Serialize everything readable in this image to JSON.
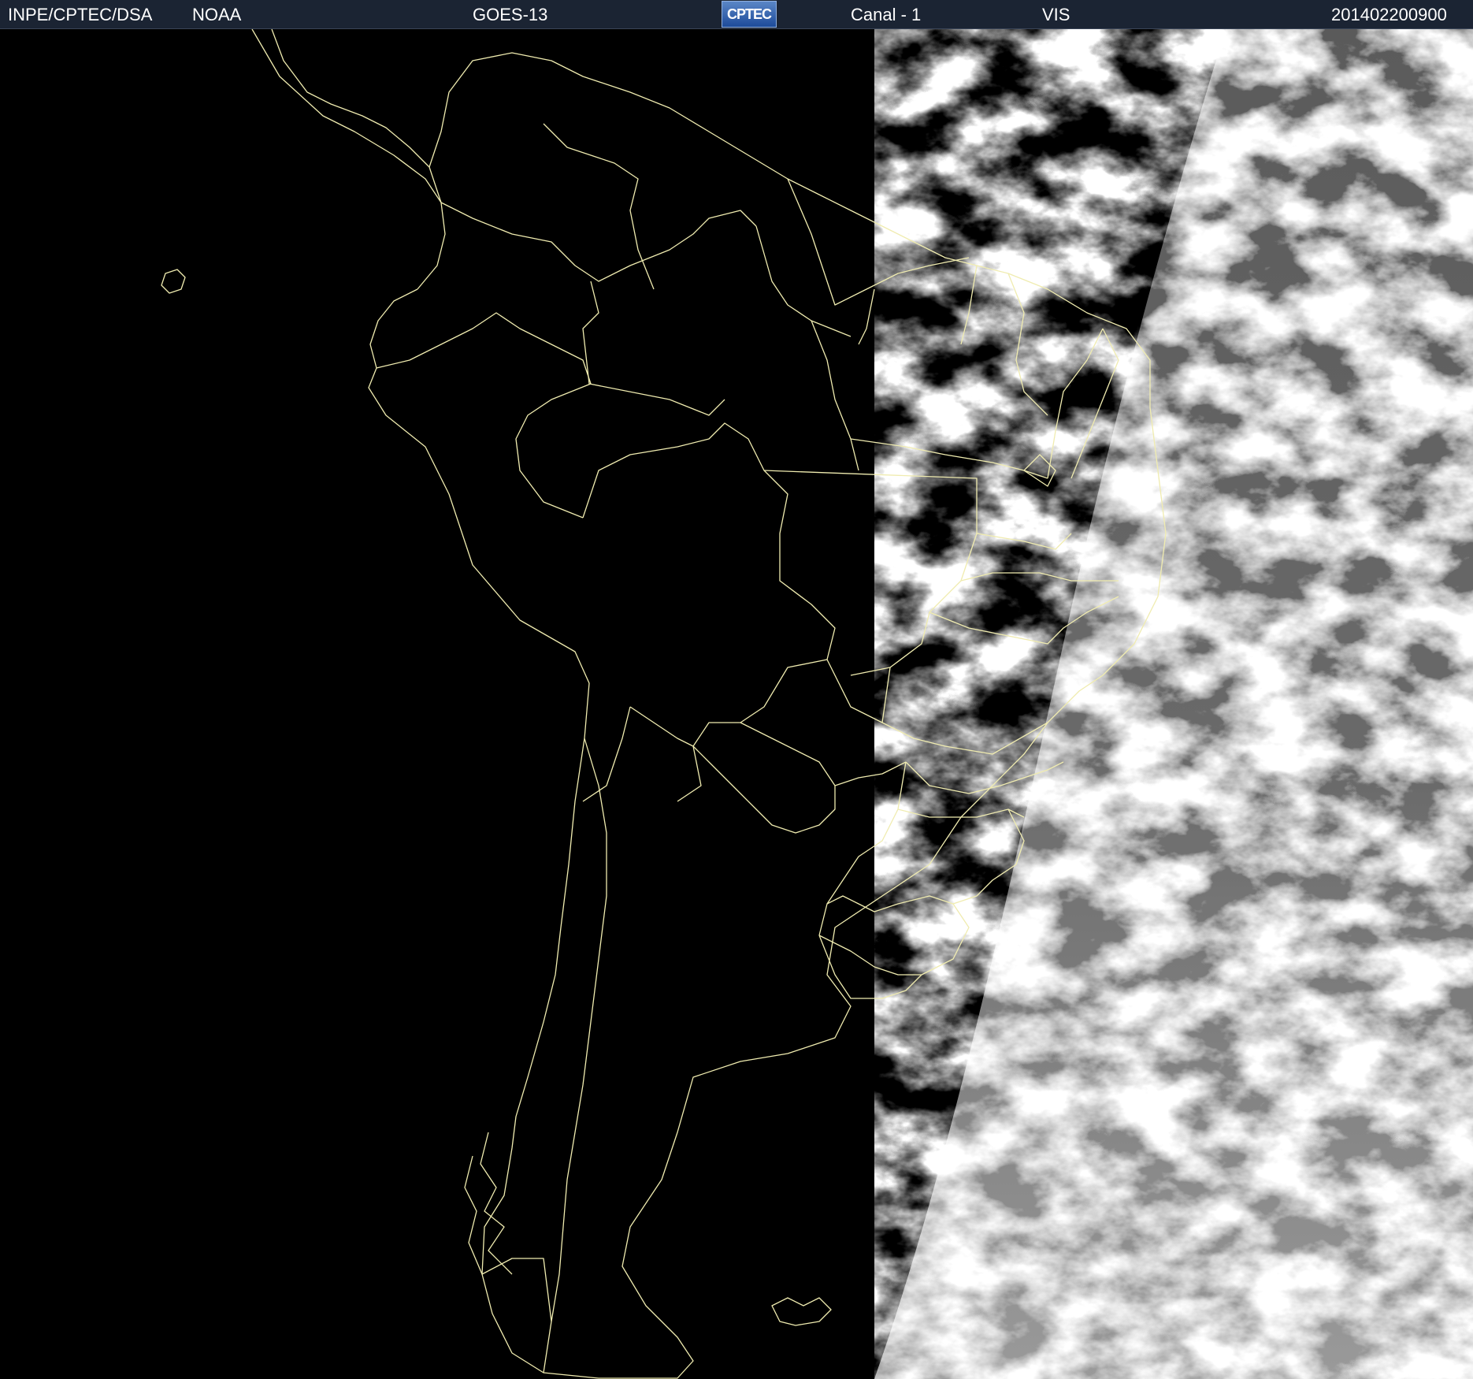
{
  "header": {
    "agency": "INPE/CPTEC/DSA",
    "provider": "NOAA",
    "satellite": "GOES-13",
    "logo_text": "CPTEC",
    "channel": "Canal - 1",
    "band": "VIS",
    "timestamp": "201402200900"
  },
  "colors": {
    "header_bg": "#1b2433",
    "night_side": "#000000",
    "day_side_cloud": "#d9d9d9",
    "borders": "#f0ecb0"
  }
}
